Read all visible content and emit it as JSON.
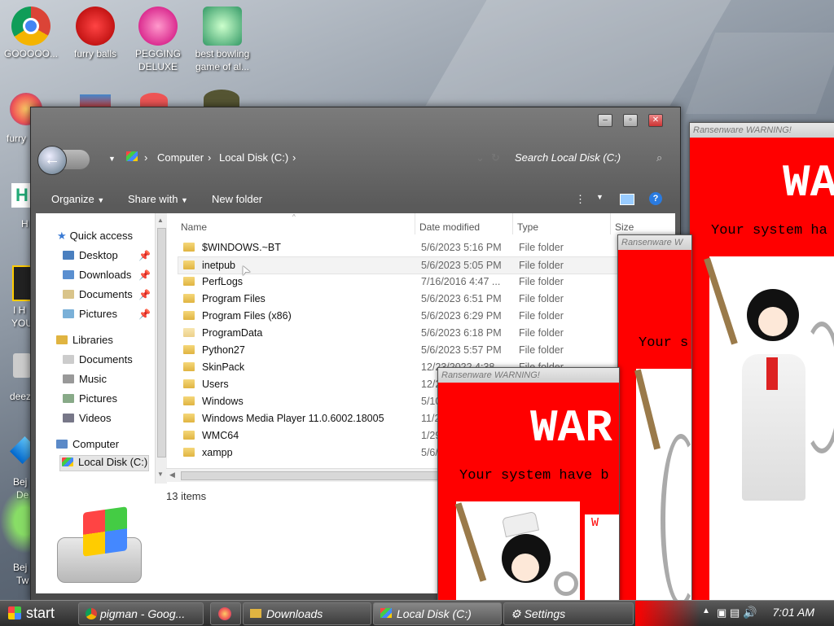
{
  "desktop": {
    "icons": [
      {
        "label": "GOOOOO..."
      },
      {
        "label": "furry balls"
      },
      {
        "label": "PEGGING DELUXE"
      },
      {
        "label": "best bowling game of al..."
      }
    ],
    "partial_labels": [
      "furry",
      "H",
      "I H",
      "YOU",
      "deez",
      "Bej",
      "De",
      "Bej",
      "Tw"
    ]
  },
  "explorer": {
    "address": {
      "crumbs": [
        "Computer",
        "Local Disk (C:)"
      ]
    },
    "search_placeholder": "Search Local Disk (C:)",
    "toolbar": {
      "organize": "Organize",
      "share_with": "Share with",
      "new_folder": "New folder"
    },
    "nav": [
      {
        "label": "Quick access",
        "pinned": false
      },
      {
        "label": "Desktop",
        "pinned": true
      },
      {
        "label": "Downloads",
        "pinned": true
      },
      {
        "label": "Documents",
        "pinned": true
      },
      {
        "label": "Pictures",
        "pinned": true
      },
      {
        "label": "Libraries",
        "pinned": false
      },
      {
        "label": "Documents",
        "pinned": false
      },
      {
        "label": "Music",
        "pinned": false
      },
      {
        "label": "Pictures",
        "pinned": false
      },
      {
        "label": "Videos",
        "pinned": false
      },
      {
        "label": "Computer",
        "pinned": false
      },
      {
        "label": "Local Disk (C:)",
        "pinned": false
      }
    ],
    "columns": {
      "name": "Name",
      "date": "Date modified",
      "type": "Type",
      "size": "Size"
    },
    "rows": [
      {
        "name": "$WINDOWS.~BT",
        "date": "5/6/2023 5:16 PM",
        "type": "File folder"
      },
      {
        "name": "inetpub",
        "date": "5/6/2023 5:05 PM",
        "type": "File folder"
      },
      {
        "name": "PerfLogs",
        "date": "7/16/2016 4:47 ...",
        "type": "File folder"
      },
      {
        "name": "Program Files",
        "date": "5/6/2023 6:51 PM",
        "type": "File folder"
      },
      {
        "name": "Program Files (x86)",
        "date": "5/6/2023 6:29 PM",
        "type": "File folder"
      },
      {
        "name": "ProgramData",
        "date": "5/6/2023 6:18 PM",
        "type": "File folder"
      },
      {
        "name": "Python27",
        "date": "5/6/2023 5:57 PM",
        "type": "File folder"
      },
      {
        "name": "SkinPack",
        "date": "12/23/2022 4:38 ...",
        "type": "File folder"
      },
      {
        "name": "Users",
        "date": "12/2",
        "type": ""
      },
      {
        "name": "Windows",
        "date": "5/10",
        "type": ""
      },
      {
        "name": "Windows Media Player 11.0.6002.18005",
        "date": "11/2",
        "type": ""
      },
      {
        "name": "WMC64",
        "date": "1/29",
        "type": ""
      },
      {
        "name": "xampp",
        "date": "5/6/",
        "type": ""
      }
    ],
    "status": "13 items"
  },
  "ransom": {
    "title": "Ransenware WARNING!",
    "title_partial": "Ransenware W",
    "headline": "WAR",
    "headline_partial": "WA",
    "message_a": "Your system ha",
    "message_b": "Your s",
    "message_c": "Your system have b",
    "side_letter": "W"
  },
  "taskbar": {
    "start": "start",
    "items": [
      {
        "label": "pigman - Goog..."
      },
      {
        "label": "Downloads"
      },
      {
        "label": "Local Disk (C:)"
      },
      {
        "label": "Settings"
      }
    ],
    "clock": "7:01 AM"
  },
  "colors": {
    "ransom_red": "#ff0000",
    "folder": "#e0b441",
    "accent_blue": "#3a7bd5"
  }
}
